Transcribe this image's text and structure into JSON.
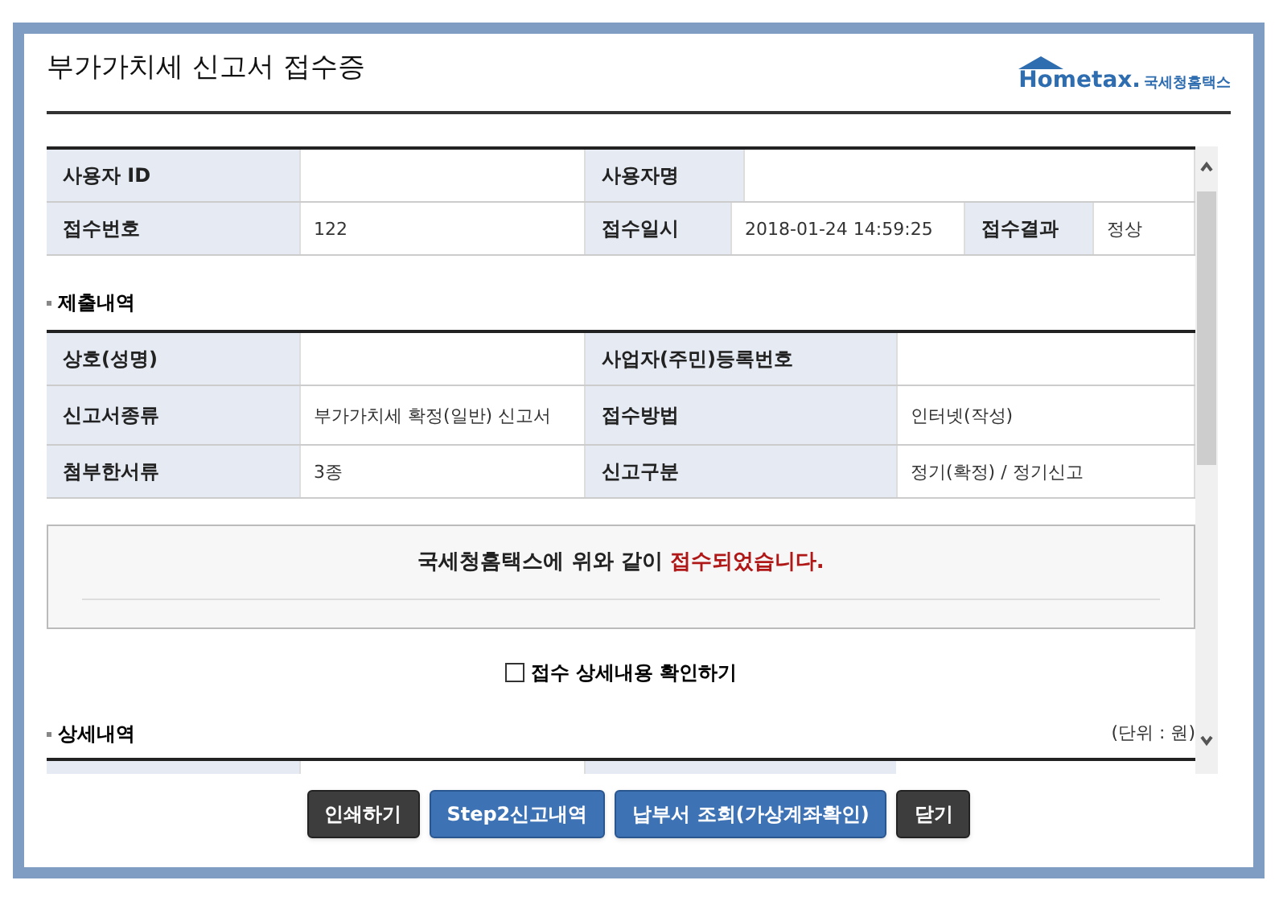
{
  "dialog": {
    "title": "부가가치세 신고서 접수증",
    "logo": {
      "brand": "Hometax.",
      "subtitle": "국세청홈택스"
    }
  },
  "receipt_table": {
    "rows": [
      [
        {
          "label": "사용자 ID"
        },
        {
          "label": "사용자명"
        }
      ],
      [
        {
          "label": "접수번호",
          "value": "122"
        },
        {
          "label": "접수일시",
          "value": "2018-01-24 14:59:25"
        },
        {
          "label": "접수결과",
          "value": "정상"
        }
      ]
    ]
  },
  "submission": {
    "heading": "제출내역",
    "rows": [
      [
        {
          "label": "상호(성명)"
        },
        {
          "label": "사업자(주민)등록번호"
        }
      ],
      [
        {
          "label": "신고서종류",
          "value": "부가가치세 확정(일반) 신고서"
        },
        {
          "label": "접수방법",
          "value": "인터넷(작성)"
        }
      ],
      [
        {
          "label": "첨부한서류",
          "value": "3종"
        },
        {
          "label": "신고구분",
          "value": "정기(확정) / 정기신고"
        }
      ]
    ]
  },
  "message": {
    "text": "국세청홈택스에 위와 같이",
    "highlight": "접수되었습니다."
  },
  "detail_checkbox": {
    "label": "접수 상세내용 확인하기",
    "checked": false
  },
  "details": {
    "heading": "상세내역",
    "unit": "(단위 : 원)"
  },
  "buttons": [
    {
      "label": "인쇄하기",
      "kind": "dark"
    },
    {
      "label": "Step2신고내역",
      "kind": "blue"
    },
    {
      "label": "납부서 조회(가상계좌확인)",
      "kind": "blue"
    },
    {
      "label": "닫기",
      "kind": "dark"
    }
  ]
}
